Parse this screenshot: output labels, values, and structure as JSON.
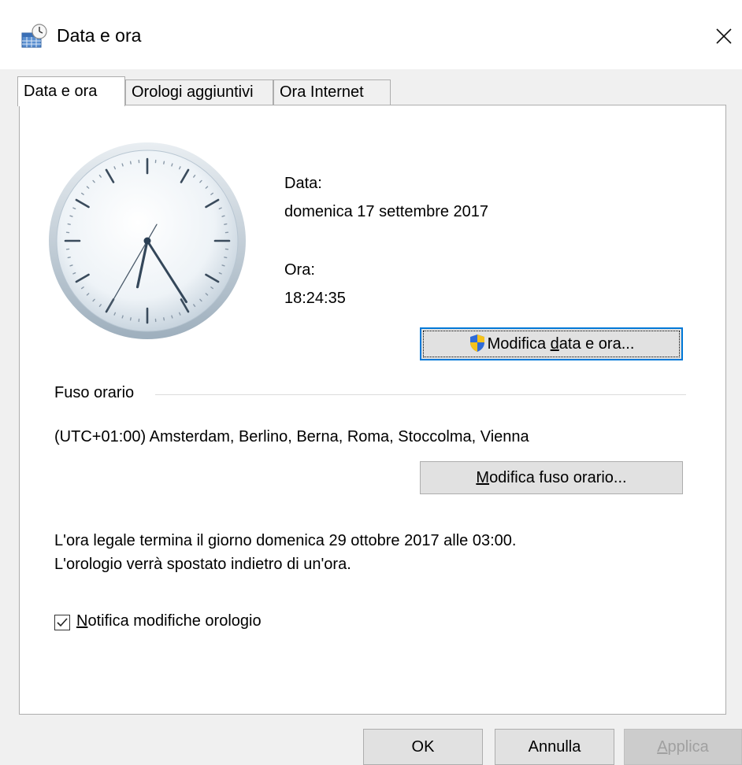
{
  "window": {
    "title": "Data e ora"
  },
  "tabs": [
    {
      "label": "Data e ora",
      "active": true
    },
    {
      "label": "Orologi aggiuntivi",
      "active": false
    },
    {
      "label": "Ora Internet",
      "active": false
    }
  ],
  "clock": {
    "time": "18:24:35"
  },
  "date_section": {
    "label": "Data:",
    "value": "domenica 17 settembre 2017"
  },
  "time_section": {
    "label": "Ora:",
    "value": "18:24:35"
  },
  "change_datetime_button": {
    "before": "Modifica ",
    "underlined": "d",
    "after": "ata e ora..."
  },
  "timezone": {
    "group_label": "Fuso orario",
    "value": "(UTC+01:00) Amsterdam, Berlino, Berna, Roma, Stoccolma, Vienna",
    "change_button": {
      "underlined": "M",
      "after": "odifica fuso orario..."
    }
  },
  "dst_note": {
    "line1": "L'ora legale termina il giorno domenica 29 ottobre 2017 alle 03:00.",
    "line2": "L'orologio verrà spostato indietro di un'ora."
  },
  "notify_checkbox": {
    "underlined": "N",
    "after": "otifica modifiche orologio",
    "checked": true
  },
  "footer": {
    "ok": "OK",
    "cancel": "Annulla",
    "apply": {
      "underlined": "A",
      "after": "pplica"
    }
  }
}
